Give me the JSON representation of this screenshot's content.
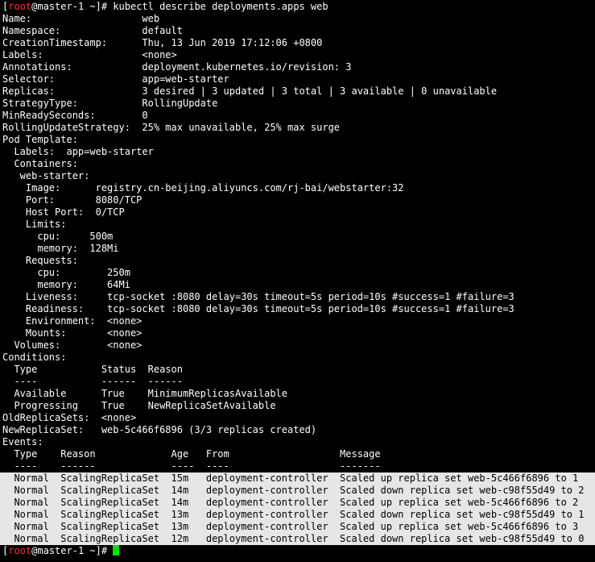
{
  "terminal": {
    "prompt": {
      "open": "[",
      "user": "root",
      "at": "@master-1 ~]# ",
      "command": "kubectl describe deployments.apps web"
    },
    "lines": [
      "Name:                   web",
      "Namespace:              default",
      "CreationTimestamp:      Thu, 13 Jun 2019 17:12:06 +0800",
      "Labels:                 <none>",
      "Annotations:            deployment.kubernetes.io/revision: 3",
      "Selector:               app=web-starter",
      "Replicas:               3 desired | 3 updated | 3 total | 3 available | 0 unavailable",
      "StrategyType:           RollingUpdate",
      "MinReadySeconds:        0",
      "RollingUpdateStrategy:  25% max unavailable, 25% max surge",
      "Pod Template:",
      "  Labels:  app=web-starter",
      "  Containers:",
      "   web-starter:",
      "    Image:      registry.cn-beijing.aliyuncs.com/rj-bai/webstarter:32",
      "    Port:       8080/TCP",
      "    Host Port:  0/TCP",
      "    Limits:",
      "      cpu:     500m",
      "      memory:  128Mi",
      "    Requests:",
      "      cpu:        250m",
      "      memory:     64Mi",
      "    Liveness:     tcp-socket :8080 delay=30s timeout=5s period=10s #success=1 #failure=3",
      "    Readiness:    tcp-socket :8080 delay=30s timeout=5s period=10s #success=1 #failure=3",
      "    Environment:  <none>",
      "    Mounts:       <none>",
      "  Volumes:        <none>",
      "Conditions:",
      "  Type           Status  Reason",
      "  ----           ------  ------",
      "  Available      True    MinimumReplicasAvailable",
      "  Progressing    True    NewReplicaSetAvailable",
      "OldReplicaSets:  <none>",
      "NewReplicaSet:   web-5c466f6896 (3/3 replicas created)",
      "Events:",
      "  Type    Reason             Age   From                   Message",
      "  ----    ------             ----  ----                   -------"
    ],
    "events": [
      "  Normal  ScalingReplicaSet  15m   deployment-controller  Scaled up replica set web-5c466f6896 to 1",
      "  Normal  ScalingReplicaSet  14m   deployment-controller  Scaled down replica set web-c98f55d49 to 2",
      "  Normal  ScalingReplicaSet  14m   deployment-controller  Scaled up replica set web-5c466f6896 to 2",
      "  Normal  ScalingReplicaSet  13m   deployment-controller  Scaled down replica set web-c98f55d49 to 1",
      "  Normal  ScalingReplicaSet  13m   deployment-controller  Scaled up replica set web-5c466f6896 to 3",
      "  Normal  ScalingReplicaSet  12m   deployment-controller  Scaled down replica set web-c98f55d49 to 0"
    ],
    "final_prompt": {
      "open": "[",
      "user": "root",
      "at": "@master-1 ~]# "
    },
    "colors": {
      "background": "#000000",
      "text": "#ffffff",
      "user": "#ff3030",
      "highlight": "#e6e6e6",
      "cursor": "#00e000"
    }
  }
}
